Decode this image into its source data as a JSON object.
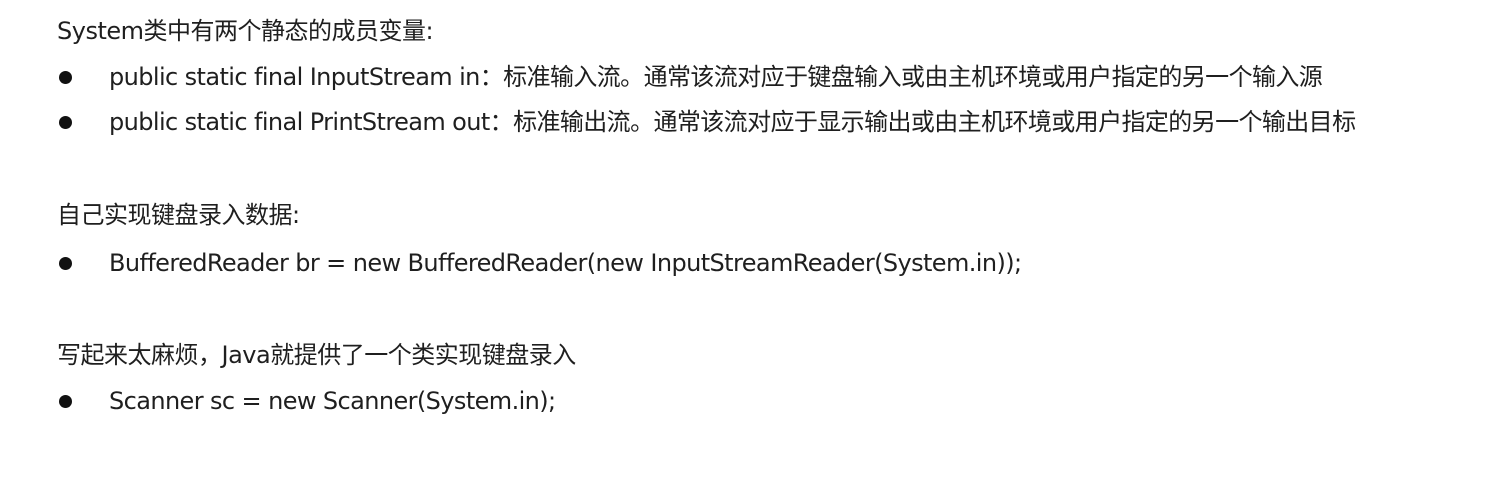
{
  "sections": [
    {
      "heading": "System类中有两个静态的成员变量:",
      "bullets": [
        "public static final InputStream in：标准输入流。通常该流对应于键盘输入或由主机环境或用户指定的另一个输入源",
        "public static final PrintStream out：标准输出流。通常该流对应于显示输出或由主机环境或用户指定的另一个输出目标"
      ]
    },
    {
      "heading": "自己实现键盘录入数据:",
      "bullets": [
        "BufferedReader br = new BufferedReader(new InputStreamReader(System.in));"
      ]
    },
    {
      "heading": "写起来太麻烦，Java就提供了一个类实现键盘录入",
      "bullets": [
        "Scanner sc = new Scanner(System.in);"
      ]
    }
  ]
}
